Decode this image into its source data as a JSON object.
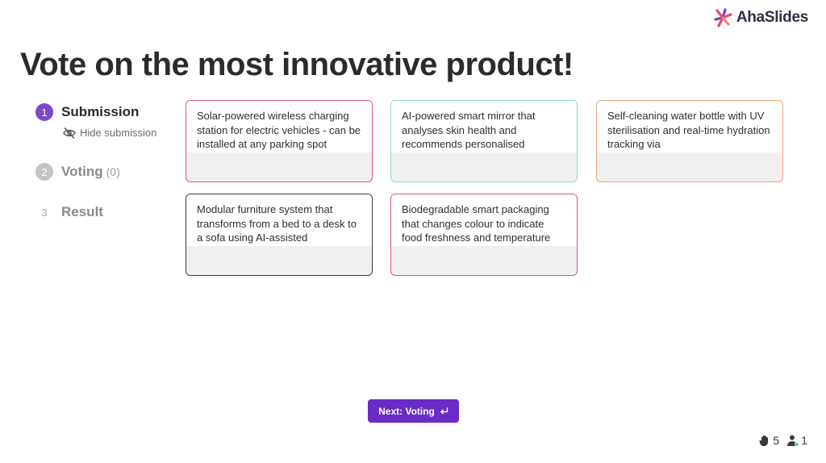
{
  "brand": {
    "name": "AhaSlides",
    "colors": {
      "pink": "#e8457a",
      "purple": "#7b3fc4",
      "text": "#2d2f45"
    }
  },
  "title": "Vote on the most innovative product!",
  "steps": [
    {
      "number": "1",
      "label": "Submission",
      "state": "active"
    },
    {
      "number": "2",
      "label": "Voting",
      "count": "(0)",
      "state": "inactive"
    },
    {
      "number": "3",
      "label": "Result",
      "state": "inactive"
    }
  ],
  "hide_submission_label": "Hide submission",
  "cards": [
    {
      "text": "Solar-powered wireless charging station for electric vehicles - can be installed at any parking spot",
      "border_color": "#e0547f"
    },
    {
      "text": "AI-powered smart mirror that analyses skin health and recommends personalised",
      "border_color": "#8fd9c7"
    },
    {
      "text": "Self-cleaning water bottle with UV sterilisation and real-time hydration tracking via",
      "border_color": "#f2a07e"
    },
    {
      "text": "Modular furniture system that transforms from a bed to a desk to a sofa using AI-assisted",
      "border_color": "#3d3d3d"
    },
    {
      "text": "Biodegradable smart packaging that changes colour to indicate food freshness and temperature",
      "border_color": "#e0547f"
    }
  ],
  "next_button": {
    "label": "Next: Voting",
    "icon": "enter-icon",
    "color": "#6a2bc6"
  },
  "stats": {
    "hands": {
      "icon": "hand-icon",
      "value": "5"
    },
    "participants": {
      "icon": "participant-icon",
      "value": "1"
    }
  }
}
